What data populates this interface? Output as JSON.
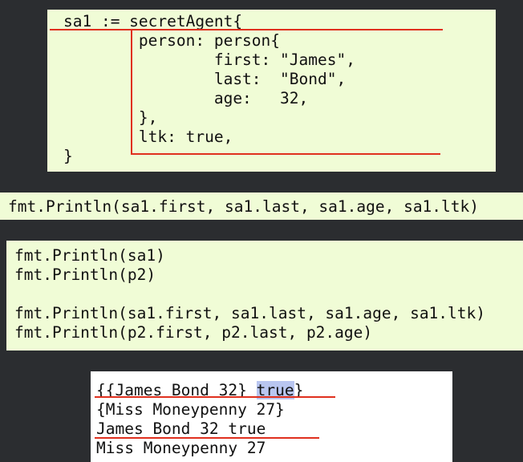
{
  "struct_literal": {
    "lines": [
      "sa1 := secretAgent{",
      "        person: person{",
      "                first: \"James\",",
      "                last:  \"Bond\",",
      "                age:   32,",
      "        },",
      "        ltk: true,",
      "}"
    ]
  },
  "single_println": {
    "line": "fmt.Println(sa1.first, sa1.last, sa1.age, sa1.ltk)"
  },
  "print_block": {
    "lines": [
      "fmt.Println(sa1)",
      "fmt.Println(p2)",
      "",
      "fmt.Println(sa1.first, sa1.last, sa1.age, sa1.ltk)",
      "fmt.Println(p2.first, p2.last, p2.age)"
    ]
  },
  "output": {
    "line1_prefix": "{{James Bond 32} ",
    "line1_highlight": "true",
    "line1_suffix": "}",
    "line2": "{Miss Moneypenny 27}",
    "line3": "James Bond 32 true",
    "line4": "Miss Moneypenny 27"
  },
  "colors": {
    "code_background": "#f0fcd6",
    "output_background": "#ffffff",
    "page_background": "#2b2d30",
    "annotation_red": "#e0301e",
    "selection_highlight": "#b9c6f0"
  }
}
